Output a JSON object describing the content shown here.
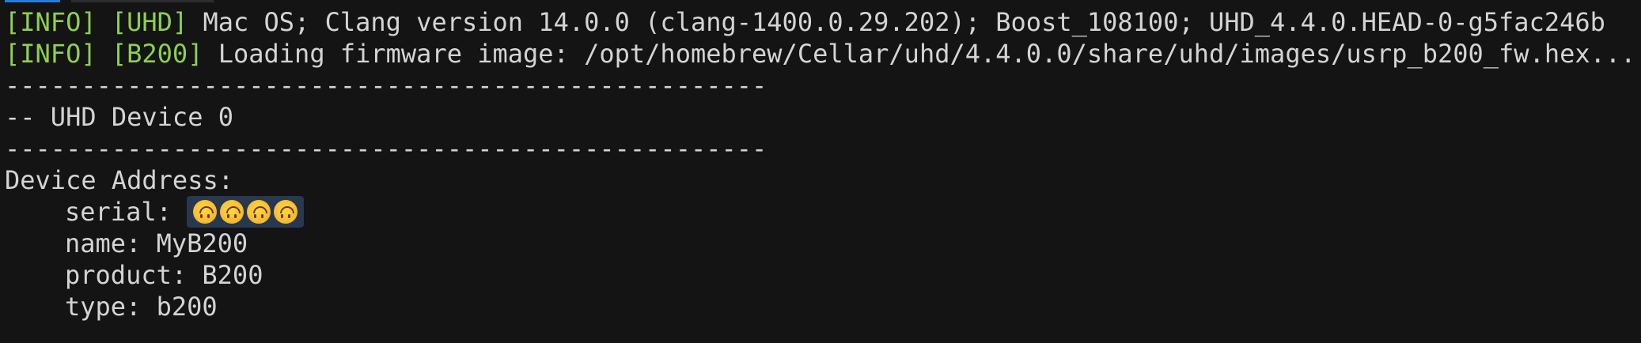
{
  "terminal": {
    "line1": {
      "tag1": "[INFO]",
      "tag2": "[UHD]",
      "text": " Mac OS; Clang version 14.0.0 (clang-1400.0.29.202); Boost_108100; UHD_4.4.0.HEAD-0-g5fac246b"
    },
    "line2": {
      "tag1": "[INFO]",
      "tag2": "[B200]",
      "text": " Loading firmware image: /opt/homebrew/Cellar/uhd/4.4.0.0/share/uhd/images/usrp_b200_fw.hex..."
    },
    "separator": "--------------------------------------------------",
    "device_header": "-- UHD Device 0",
    "device_address_label": "Device Address:",
    "serial_label": "serial: ",
    "serial_value_icons": [
      "upside-down-face-emoji",
      "upside-down-face-emoji",
      "upside-down-face-emoji",
      "upside-down-face-emoji"
    ],
    "name_line": "name: MyB200",
    "product_line": "product: B200",
    "type_line": "type: b200"
  },
  "colors": {
    "background": "#141414",
    "text": "#d4d4d4",
    "tag": "#8ed04f",
    "redaction_highlight": "#27384f"
  }
}
